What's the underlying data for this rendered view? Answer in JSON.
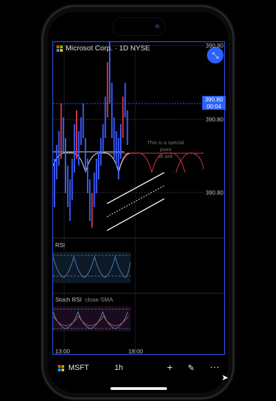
{
  "chart": {
    "title": "Microsot Corp. · 1D  NYSE",
    "price_labels": [
      "390.80",
      "390.80",
      "390.80"
    ],
    "price_badge": {
      "price": "390.80",
      "countdown": "00:04"
    },
    "annotation_line1": "This is a special point",
    "annotation_line2": "to sell",
    "time_labels": [
      "13:00",
      "18:00"
    ]
  },
  "panes": {
    "rsi_label": "RSI",
    "stoch_label": "Stoch RSI",
    "stoch_sub": "close SMA"
  },
  "toolbar": {
    "symbol": "MSFT",
    "interval": "1h"
  },
  "icons": {
    "collapse": "collapse-icon",
    "add": "plus-icon",
    "draw": "pen-icon",
    "more": "more-icon"
  },
  "colors": {
    "accent": "#2962ff",
    "candle": "#2f5bff",
    "bear": "#d1384a"
  }
}
